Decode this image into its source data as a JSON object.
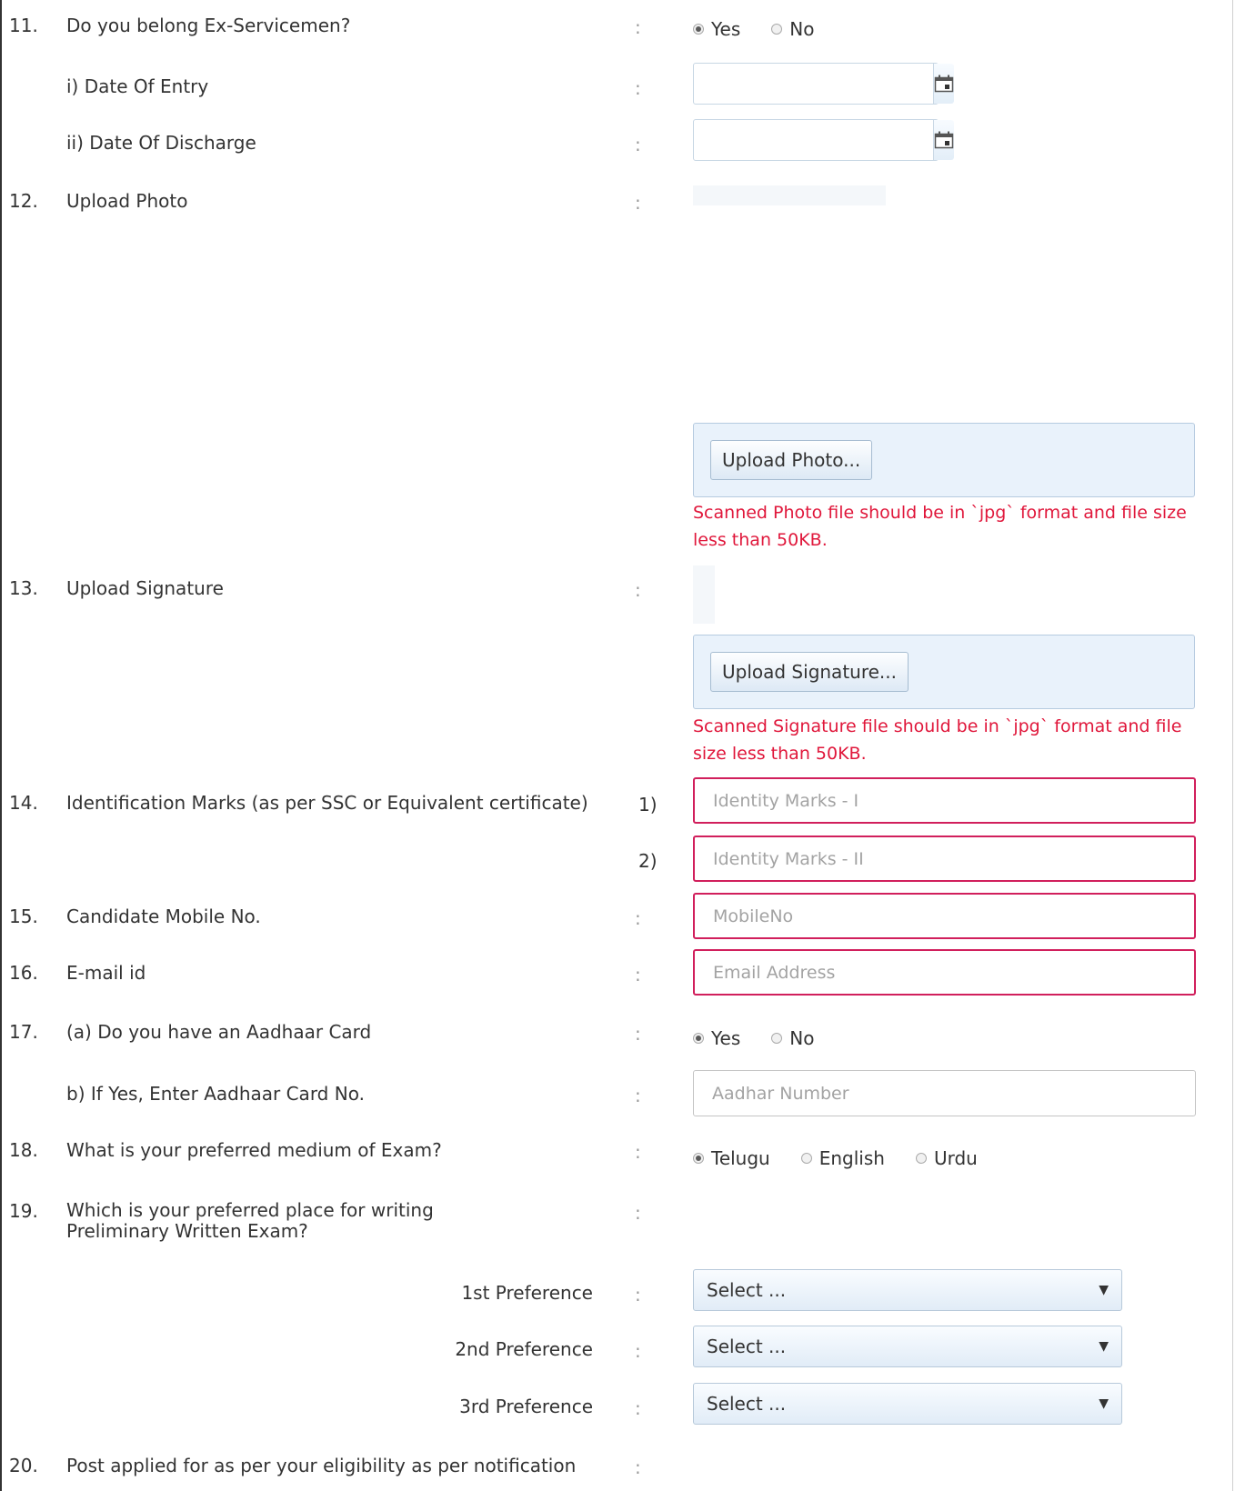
{
  "radio_options": {
    "yes": "Yes",
    "no": "No"
  },
  "q11": {
    "num": "11.",
    "label": "Do you belong Ex-Servicemen?",
    "colon": ":",
    "selected": "Yes",
    "sub1": {
      "label": "i) Date Of Entry",
      "colon": ":",
      "value": ""
    },
    "sub2": {
      "label": "ii) Date Of Discharge",
      "colon": ":",
      "value": ""
    }
  },
  "q12": {
    "num": "12.",
    "label": "Upload Photo",
    "colon": ":",
    "button": "Upload Photo...",
    "hint": "Scanned Photo file should be in `jpg` format and file size less than 50KB."
  },
  "q13": {
    "num": "13.",
    "label": "Upload Signature",
    "colon": ":",
    "button": "Upload Signature...",
    "hint": "Scanned Signature file should be in `jpg` format and file size less than 50KB."
  },
  "q14": {
    "num": "14.",
    "label": "Identification Marks (as per SSC or Equivalent certificate)",
    "marker1": "1)",
    "marker2": "2)",
    "placeholder1": "Identity Marks - I",
    "placeholder2": "Identity Marks - II"
  },
  "q15": {
    "num": "15.",
    "label": "Candidate Mobile No.",
    "colon": ":",
    "placeholder": "MobileNo"
  },
  "q16": {
    "num": "16.",
    "label": "E-mail id",
    "colon": ":",
    "placeholder": "Email Address"
  },
  "q17": {
    "num": "17.",
    "label": "(a) Do you have an Aadhaar Card",
    "colon": ":",
    "selected": "Yes",
    "sub": {
      "label": "b) If Yes, Enter Aadhaar Card No.",
      "colon": ":",
      "placeholder": "Aadhar Number"
    }
  },
  "q18": {
    "num": "18.",
    "label": "What is your preferred medium of Exam?",
    "colon": ":",
    "options": [
      "Telugu",
      "English",
      "Urdu"
    ],
    "selected": "Telugu"
  },
  "q19": {
    "num": "19.",
    "label": "Which is your preferred place for writing Preliminary Written Exam?",
    "colon": ":",
    "prefs": [
      {
        "label": "1st Preference",
        "colon": ":",
        "value": "Select ..."
      },
      {
        "label": "2nd Preference",
        "colon": ":",
        "value": "Select ..."
      },
      {
        "label": "3rd Preference",
        "colon": ":",
        "value": "Select ..."
      }
    ]
  },
  "q20": {
    "num": "20.",
    "label": "Post applied for as per your eligibility as per notification",
    "colon": ":"
  },
  "icons": {
    "calendar": "calendar-icon",
    "dropdown": "chevron-down-icon"
  },
  "colors": {
    "error_red": "#e0173b",
    "required_border": "#d11f5c",
    "upload_bg": "#e9f2fb"
  }
}
